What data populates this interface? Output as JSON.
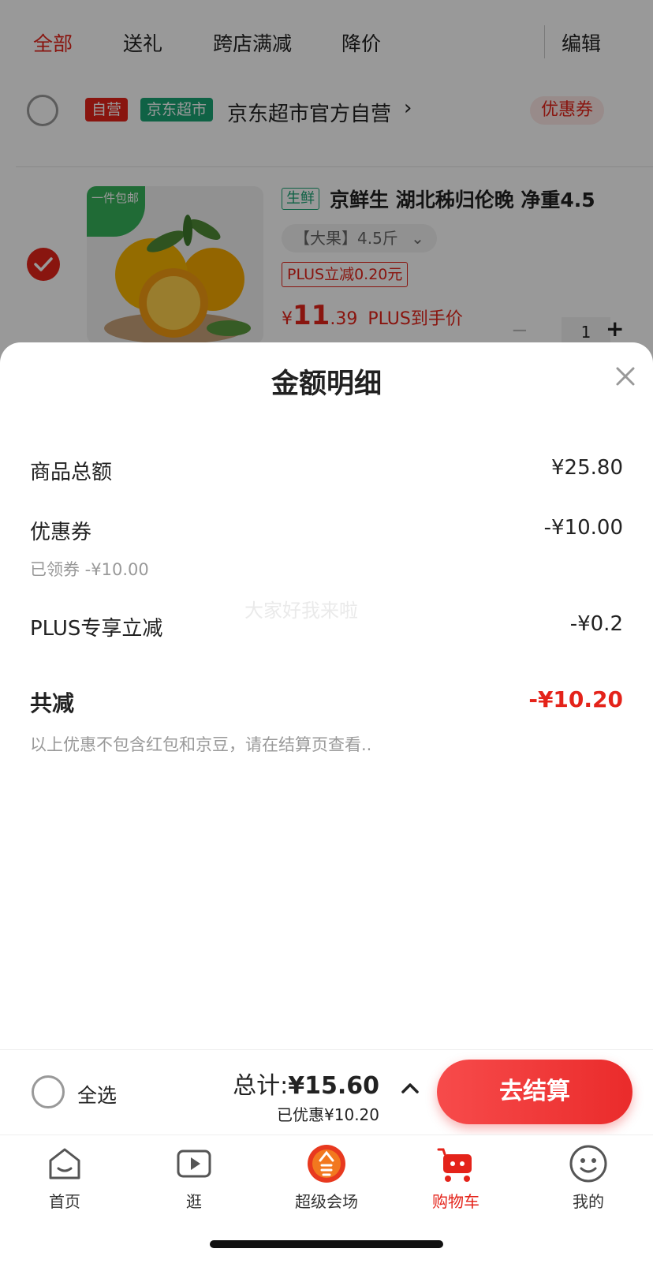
{
  "filter_tabs": [
    "全部",
    "送礼",
    "跨店满减",
    "降价"
  ],
  "edit_label": "编辑",
  "shop": {
    "tag_self": "自营",
    "tag_market": "京东超市",
    "name": "京东超市官方自营",
    "chevron": "›",
    "coupon_label": "优惠券"
  },
  "product": {
    "free_ship_tag": "一件包邮",
    "fresh_tag": "生鲜",
    "title": "京鲜生 湖北秭归伦晚 净重4.5",
    "spec": "【大果】4.5斤",
    "plus_promo": "PLUS立减0.20元",
    "price_symbol": "¥",
    "price_int": "11",
    "price_dec": ".39",
    "price_suffix": "PLUS到手价",
    "quantity": "1"
  },
  "sheet": {
    "title": "金额明细",
    "rows": [
      {
        "label": "商品总额",
        "value": "¥25.80"
      },
      {
        "label": "优惠券",
        "value": "-¥10.00"
      },
      {
        "label": "PLUS专享立减",
        "value": "-¥0.2"
      }
    ],
    "coupon_sub": "已领券 -¥10.00",
    "total_label": "共减",
    "total_value": "-¥10.20",
    "note": "以上优惠不包含红包和京豆，请在结算页查看..",
    "watermark": "大家好我来啦"
  },
  "checkout": {
    "select_all": "全选",
    "total_prefix": "总计:",
    "total_amount": "¥15.60",
    "discount": "已优惠¥10.20",
    "button": "去结算"
  },
  "nav": [
    {
      "label": "首页",
      "icon": "home-icon"
    },
    {
      "label": "逛",
      "icon": "video-icon"
    },
    {
      "label": "超级会场",
      "icon": "super-venue-icon"
    },
    {
      "label": "购物车",
      "icon": "cart-icon"
    },
    {
      "label": "我的",
      "icon": "profile-icon"
    }
  ],
  "colors": {
    "accent": "#e4231a",
    "green": "#1aa374"
  }
}
